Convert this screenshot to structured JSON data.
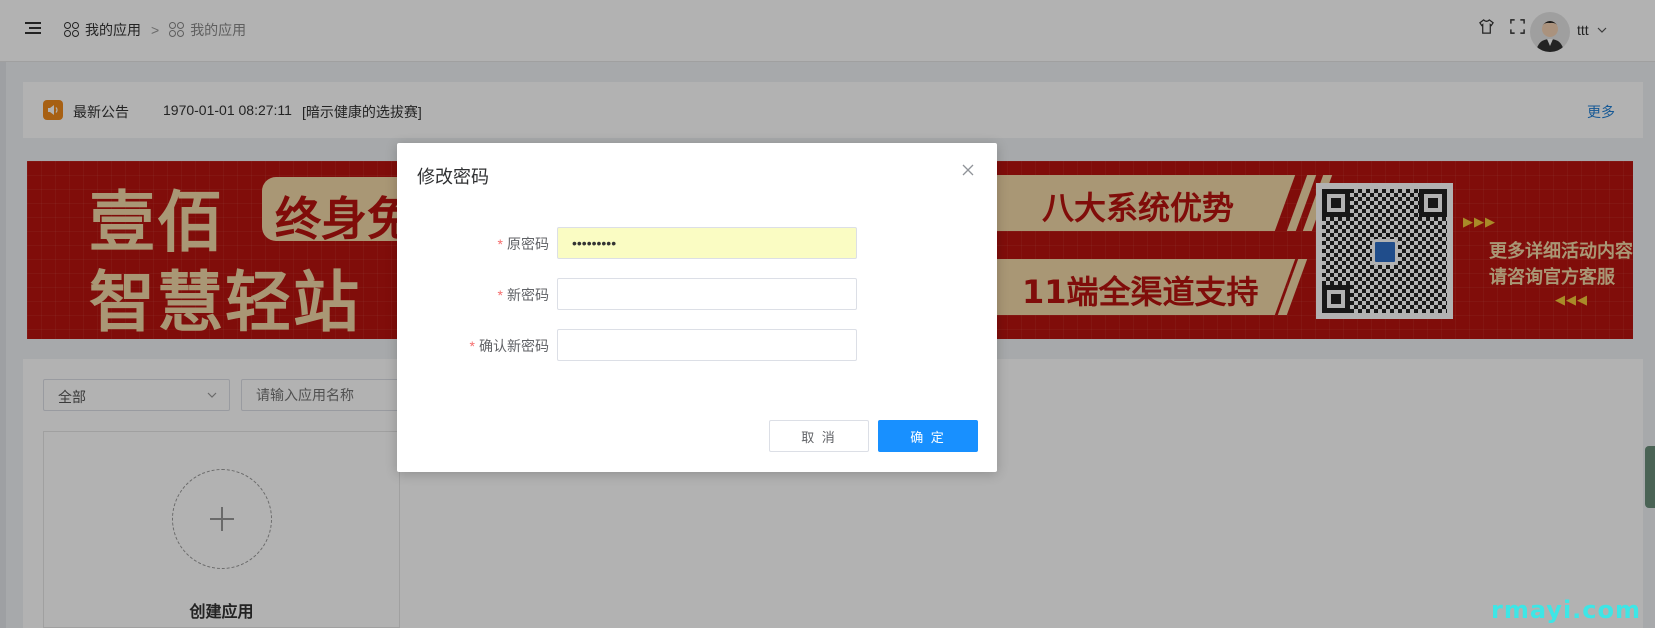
{
  "header": {
    "breadcrumb": [
      "我的应用",
      "我的应用"
    ],
    "breadcrumb_separator": ">",
    "username": "ttt"
  },
  "notice": {
    "label": "最新公告",
    "time": "1970-01-01 08:27:11",
    "title": "[暗示健康的选拔赛]",
    "more": "更多",
    "icon_color": "#f08a1c",
    "more_color": "#1f7fd6"
  },
  "banner": {
    "line1": "壹佰",
    "line2": "智慧轻站",
    "pill_text": "终身免",
    "ribbon1": "八大系统优势",
    "ribbon2": "11端全渠道支持",
    "side1": "更多详细活动内容",
    "side2": "请咨询官方客服",
    "bg_color": "#b8140f",
    "accent_color": "#f3d9a8"
  },
  "apps": {
    "filter_value": "全部",
    "search_placeholder": "请输入应用名称",
    "create_label": "创建应用"
  },
  "dialog": {
    "title": "修改密码",
    "fields": [
      {
        "label": "原密码",
        "value": "•••••••••",
        "placeholder": ""
      },
      {
        "label": "新密码",
        "value": "",
        "placeholder": ""
      },
      {
        "label": "确认新密码",
        "value": "",
        "placeholder": ""
      }
    ],
    "required_mark": "*",
    "cancel_label": "取 消",
    "ok_label": "确 定",
    "ok_color": "#1890ff"
  },
  "watermark": "rmayi.com"
}
